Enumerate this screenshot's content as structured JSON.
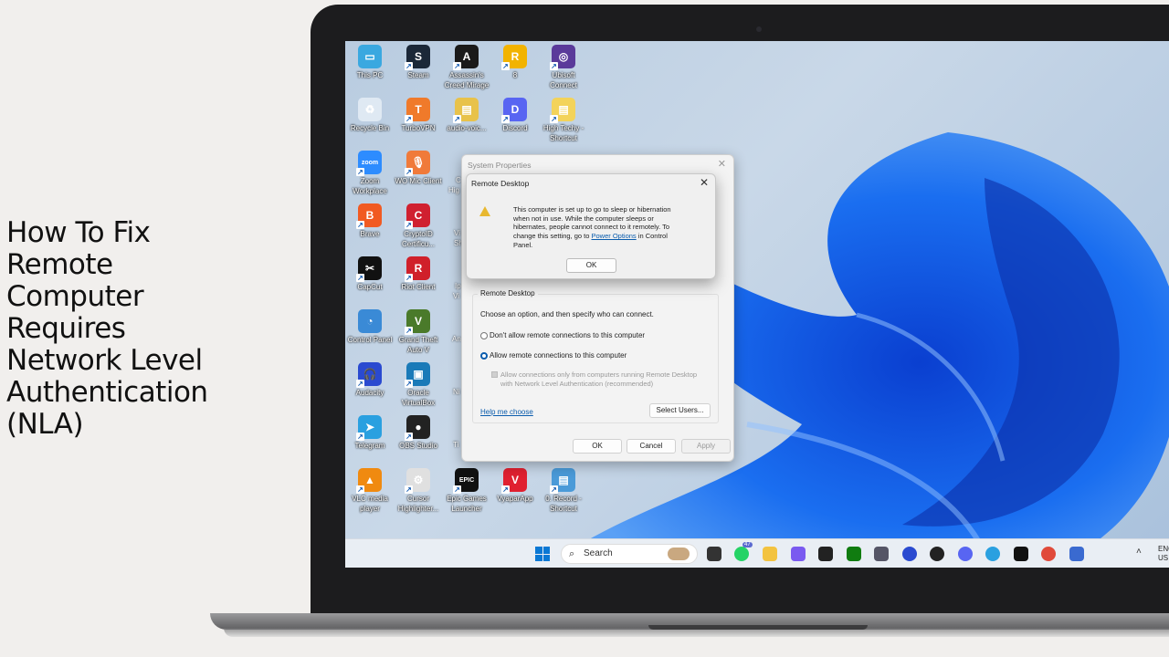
{
  "video_title": "How To Fix Remote Computer Requires Network Level Authentication (NLA)",
  "desktop_icons": [
    {
      "label": "This PC",
      "color": "#3aa8e0",
      "glyph": "▭"
    },
    {
      "label": "Steam",
      "color": "#1b2838",
      "glyph": "S"
    },
    {
      "label": "Assassin's Creed Mirage",
      "color": "#1a1a1a",
      "glyph": "A"
    },
    {
      "label": "8",
      "color": "#f2b300",
      "glyph": "R"
    },
    {
      "label": "Ubisoft Connect",
      "color": "#5a3a9a",
      "glyph": "◎"
    },
    {
      "label": "Recycle Bin",
      "color": "#dfe9f3",
      "glyph": "♻"
    },
    {
      "label": "TurboVPN",
      "color": "#f07a2a",
      "glyph": "T"
    },
    {
      "label": "audio-voic...",
      "color": "#e8c24a",
      "glyph": "▤"
    },
    {
      "label": "Discord",
      "color": "#5865f2",
      "glyph": "D"
    },
    {
      "label": "High Techy - Shortcut",
      "color": "#f3d35a",
      "glyph": "▤"
    },
    {
      "label": "Zoom Workplace",
      "color": "#2d8cff",
      "glyph": "zoom"
    },
    {
      "label": "WO Mic Client",
      "color": "#f07a3a",
      "glyph": "🎙"
    },
    {
      "label": "Brave",
      "color": "#f15a22",
      "glyph": "B"
    },
    {
      "label": "CryptoID Certificu...",
      "color": "#d02030",
      "glyph": "C"
    },
    {
      "label": "CapCut",
      "color": "#111",
      "glyph": "✂"
    },
    {
      "label": "Riot Client",
      "color": "#d0202a",
      "glyph": "R"
    },
    {
      "label": "Control Panel",
      "color": "#3a8ad6",
      "glyph": "◔"
    },
    {
      "label": "Grand Theft Auto V",
      "color": "#4a7a2a",
      "glyph": "V"
    },
    {
      "label": "Audacity",
      "color": "#2a4ad0",
      "glyph": "🎧"
    },
    {
      "label": "Oracle VirtualBox",
      "color": "#1a7ab8",
      "glyph": "▣"
    },
    {
      "label": "Telegram",
      "color": "#2aa0e0",
      "glyph": "➤"
    },
    {
      "label": "OBS Studio",
      "color": "#222",
      "glyph": "●"
    },
    {
      "label": "VLC media player",
      "color": "#f08a10",
      "glyph": "▲"
    },
    {
      "label": "Cursor Highlighter...",
      "color": "#e0e0e0",
      "glyph": "⚙"
    },
    {
      "label": "Epic Games Launcher",
      "color": "#111",
      "glyph": "EPIC"
    },
    {
      "label": "VyaparApp",
      "color": "#e02030",
      "glyph": "V"
    },
    {
      "label": "0. Record - Shortcut",
      "color": "#4a9ad8",
      "glyph": "▤"
    }
  ],
  "partial_icons": [
    "C",
    "Hig",
    "Vi",
    "Sh",
    "Ip",
    "Vi",
    "An",
    "Ni",
    "Ti"
  ],
  "system_properties": {
    "title": "System Properties",
    "group_label": "Remote Desktop",
    "instruction": "Choose an option, and then specify who can connect.",
    "option_deny": "Don't allow remote connections to this computer",
    "option_allow": "Allow remote connections to this computer",
    "selected_option": "allow",
    "nla_line1": "Allow connections only from computers running Remote Desktop",
    "nla_line2": "with Network Level Authentication (recommended)",
    "nla_checked": false,
    "help_link": "Help me choose",
    "select_users": "Select Users...",
    "ok": "OK",
    "cancel": "Cancel",
    "apply": "Apply"
  },
  "remote_desktop_dialog": {
    "title": "Remote Desktop",
    "message_before": "This computer is set up to go to sleep or hibernation when not in use. While the computer sleeps or hibernates, people cannot connect to it remotely. To change this setting, go to ",
    "link": "Power Options",
    "message_after": " in Control Panel.",
    "ok": "OK"
  },
  "taskbar": {
    "search_placeholder": "Search",
    "whatsapp_badge": "47",
    "lang_line1": "ENG",
    "lang_line2": "US",
    "apps": [
      {
        "name": "task-view",
        "color": "#333"
      },
      {
        "name": "whatsapp",
        "color": "#25d366"
      },
      {
        "name": "file-explorer",
        "color": "#f3c340"
      },
      {
        "name": "copilot",
        "color": "#7a5af0"
      },
      {
        "name": "sticky-notes",
        "color": "#222"
      },
      {
        "name": "xbox",
        "color": "#107c10"
      },
      {
        "name": "calculator",
        "color": "#556"
      },
      {
        "name": "audacity",
        "color": "#2a4ad0"
      },
      {
        "name": "obs-studio",
        "color": "#222"
      },
      {
        "name": "discord",
        "color": "#5865f2"
      },
      {
        "name": "telegram",
        "color": "#2aa0e0"
      },
      {
        "name": "capcut",
        "color": "#111"
      },
      {
        "name": "chrome",
        "color": "#e04a3a"
      },
      {
        "name": "remote-desktop",
        "color": "#3a6ad0"
      }
    ]
  }
}
